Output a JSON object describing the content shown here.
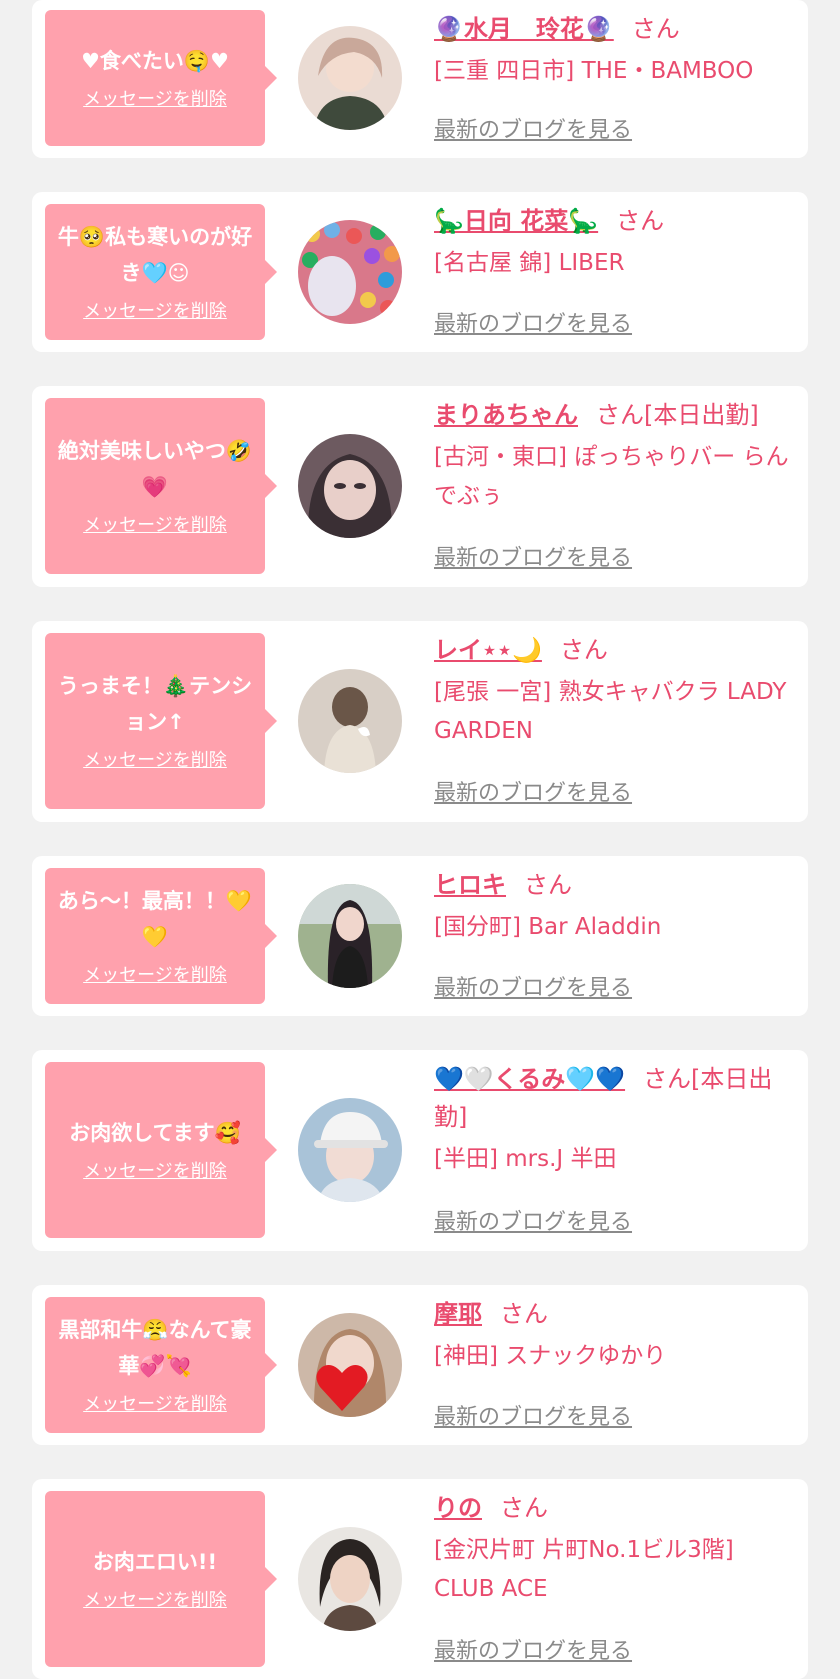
{
  "common": {
    "delete_label": "メッセージを削除",
    "blog_label": "最新のブログを見る"
  },
  "items": [
    {
      "message": "♥食べたい🤤♥",
      "name": "🔮水月　玲花🔮",
      "suffix": "さん",
      "shop": "[三重 四日市] THE・BAMBOO",
      "avatar_icon": "woman-photo-icon",
      "avatar_color": "#c9a89a"
    },
    {
      "message": "牛🥺私も寒いのが好き🩵☺",
      "name": "🦕日向 花菜🦕",
      "suffix": "さん",
      "shop": "[名古屋 錦] LIBER",
      "avatar_icon": "ball-pit-photo-icon",
      "avatar_color": "#d9788a"
    },
    {
      "message": "絶対美味しいやつ🤣💗",
      "name": "まりあちゃん",
      "suffix": "さん[本日出勤]",
      "shop": "[古河・東口] ぽっちゃりバー らんでぶぅ",
      "avatar_icon": "woman-photo-icon",
      "avatar_color": "#6d5a60"
    },
    {
      "message": "うっまそ！🎄テンション↑",
      "name": "レイ⋆⋆🌙",
      "suffix": "さん",
      "shop": "[尾張 一宮] 熟女キャバクラ LADY GARDEN",
      "avatar_icon": "woman-back-photo-icon",
      "avatar_color": "#d8cfc6"
    },
    {
      "message": "あら～！最高！！💛💛",
      "name": "ヒロキ",
      "suffix": "さん",
      "shop": "[国分町] Bar Aladdin",
      "avatar_icon": "woman-photo-icon",
      "avatar_color": "#5b6a55"
    },
    {
      "message": "お肉欲してます🥰",
      "name": "💙🤍くるみ🩵💙",
      "suffix": "さん[本日出勤]",
      "shop": "[半田] mrs.J 半田",
      "avatar_icon": "woman-cap-photo-icon",
      "avatar_color": "#a9c3d8"
    },
    {
      "message": "黒部和牛😤なんて豪華💞💘",
      "name": "摩耶",
      "suffix": "さん",
      "shop": "[神田] スナックゆかり",
      "avatar_icon": "heart-photo-icon",
      "avatar_color": "#cdb8a8"
    },
    {
      "message": "お肉エロい!!",
      "name": "りの",
      "suffix": "さん",
      "shop": "[金沢片町 片町No.1ビル3階] CLUB ACE",
      "avatar_icon": "woman-photo-icon",
      "avatar_color": "#b89d8c"
    }
  ]
}
